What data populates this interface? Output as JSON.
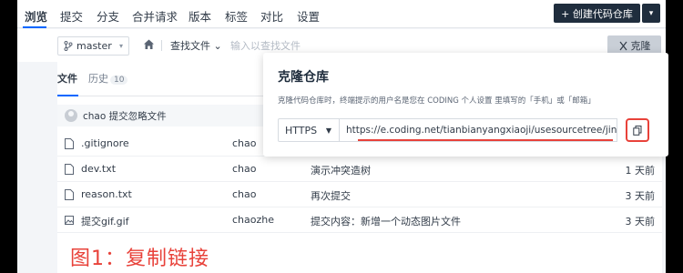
{
  "nav": {
    "tabs": [
      "浏览",
      "提交",
      "分支",
      "合并请求",
      "版本",
      "标签",
      "对比",
      "设置"
    ],
    "active_tab": "浏览",
    "create_repo_button": "+ 创建代码仓库",
    "create_more": "▾"
  },
  "toolbar": {
    "branch": "master",
    "find_file": "查找文件 ⌄",
    "find_placeholder": "输入以查找文件",
    "clone_button": "克隆"
  },
  "panel": {
    "tabs": {
      "files": "文件",
      "history": "历史",
      "history_count": "10"
    },
    "last_commit": "chao 提交忽略文件",
    "files": [
      {
        "icon": "file-icon",
        "name": ".gitignore",
        "author": "chao",
        "message": "",
        "time": ""
      },
      {
        "icon": "file-icon",
        "name": "dev.txt",
        "author": "chao",
        "message": "演示冲突造树",
        "time": "1 天前"
      },
      {
        "icon": "file-icon",
        "name": "reason.txt",
        "author": "chao",
        "message": "再次提交",
        "time": "3 天前"
      },
      {
        "icon": "image-icon",
        "name": "提交gif.gif",
        "author": "chaozhe",
        "message": "提交内容：新增一个动态图片文件",
        "time": "3 天前"
      }
    ]
  },
  "clone_popup": {
    "title": "克隆仓库",
    "description": "克隆代码仓库时，终端提示的用户名是您在 CODING 个人设置 里填写的「手机」或「邮箱」",
    "protocol": "HTTPS",
    "url": "https://e.coding.net/tianbianyangxiaoji/usesourcetree/jinsi"
  },
  "caption": "图1：复制链接",
  "colors": {
    "accent": "#0066ff",
    "annotation_red": "#e8423a",
    "dark_button": "#1f2d3d"
  }
}
